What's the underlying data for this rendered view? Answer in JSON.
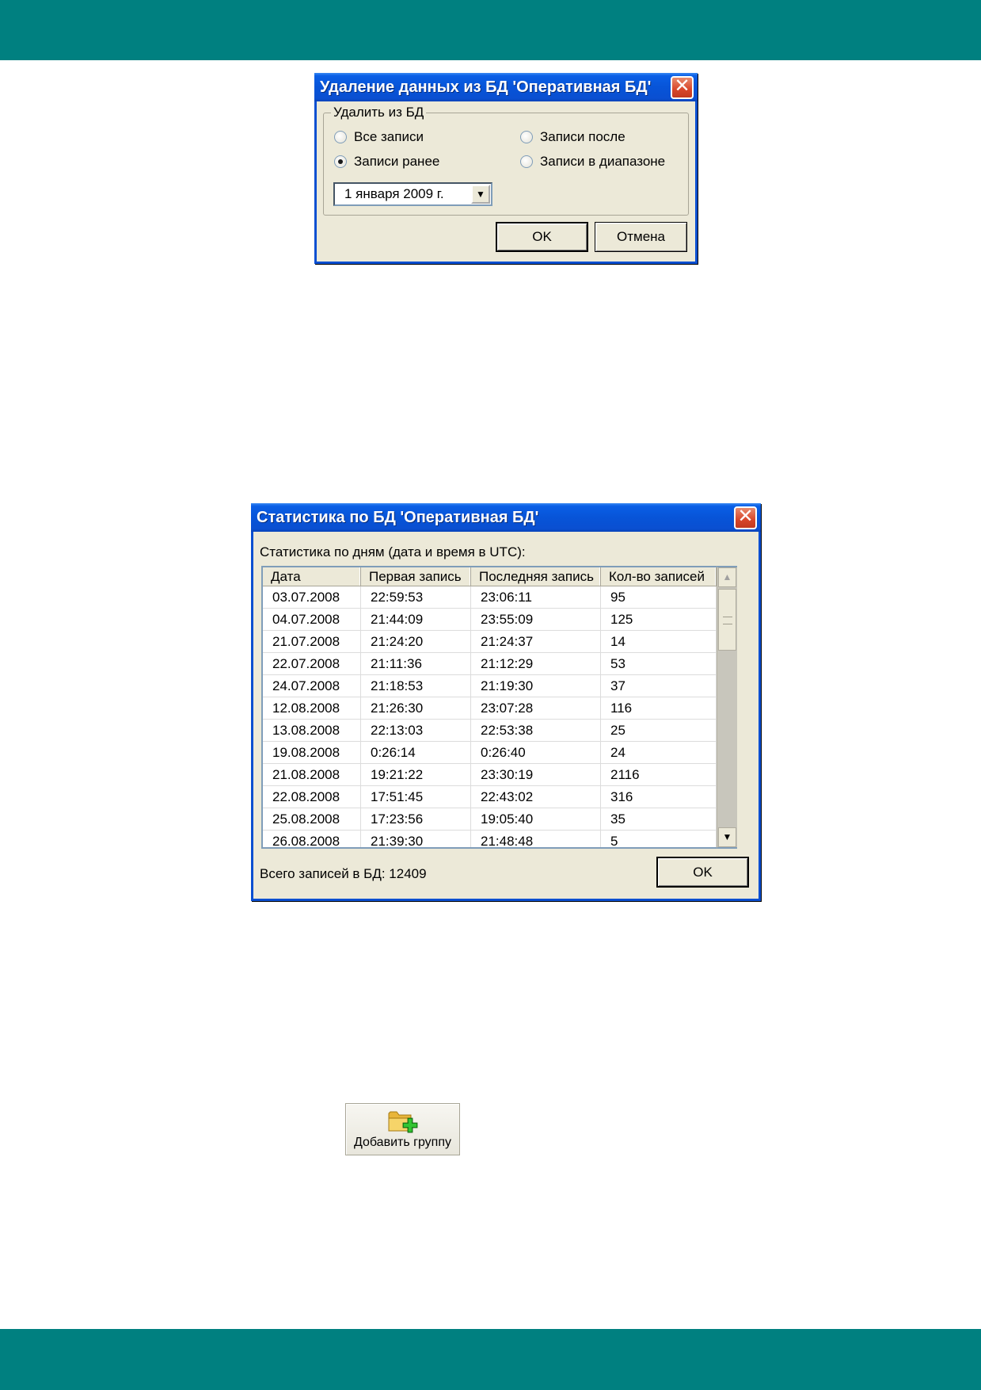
{
  "delete_dialog": {
    "title": "Удаление данных из БД 'Оперативная БД'",
    "group_label": "Удалить из БД",
    "options": [
      {
        "label": "Все записи",
        "checked": false
      },
      {
        "label": "Записи после",
        "checked": false
      },
      {
        "label": "Записи ранее",
        "checked": true
      },
      {
        "label": "Записи в диапазоне",
        "checked": false
      }
    ],
    "date_value": "1   января   2009 г.",
    "ok_label": "OK",
    "cancel_label": "Отмена"
  },
  "stats_dialog": {
    "title": "Статистика по БД 'Оперативная БД'",
    "caption": "Статистика по дням (дата и время в UTC):",
    "columns": [
      "Дата",
      "Первая запись",
      "Последняя запись",
      "Кол-во записей"
    ],
    "rows": [
      [
        "03.07.2008",
        "22:59:53",
        "23:06:11",
        "95"
      ],
      [
        "04.07.2008",
        "21:44:09",
        "23:55:09",
        "125"
      ],
      [
        "21.07.2008",
        "21:24:20",
        "21:24:37",
        "14"
      ],
      [
        "22.07.2008",
        "21:11:36",
        "21:12:29",
        "53"
      ],
      [
        "24.07.2008",
        "21:18:53",
        "21:19:30",
        "37"
      ],
      [
        "12.08.2008",
        "21:26:30",
        "23:07:28",
        "116"
      ],
      [
        "13.08.2008",
        "22:13:03",
        "22:53:38",
        "25"
      ],
      [
        "19.08.2008",
        "0:26:14",
        "0:26:40",
        "24"
      ],
      [
        "21.08.2008",
        "19:21:22",
        "23:30:19",
        "2116"
      ],
      [
        "22.08.2008",
        "17:51:45",
        "22:43:02",
        "316"
      ],
      [
        "25.08.2008",
        "17:23:56",
        "19:05:40",
        "35"
      ],
      [
        "26.08.2008",
        "21:39:30",
        "21:48:48",
        "5"
      ]
    ],
    "total_label": "Всего записей в БД: 12409",
    "ok_label": "OK"
  },
  "toolbar": {
    "add_group_label": "Добавить группу",
    "add_group_icon": "folder-add-icon"
  },
  "colors": {
    "band": "#008080",
    "titlebar": "#0a4fd1",
    "window_bg": "#ece9d8"
  }
}
